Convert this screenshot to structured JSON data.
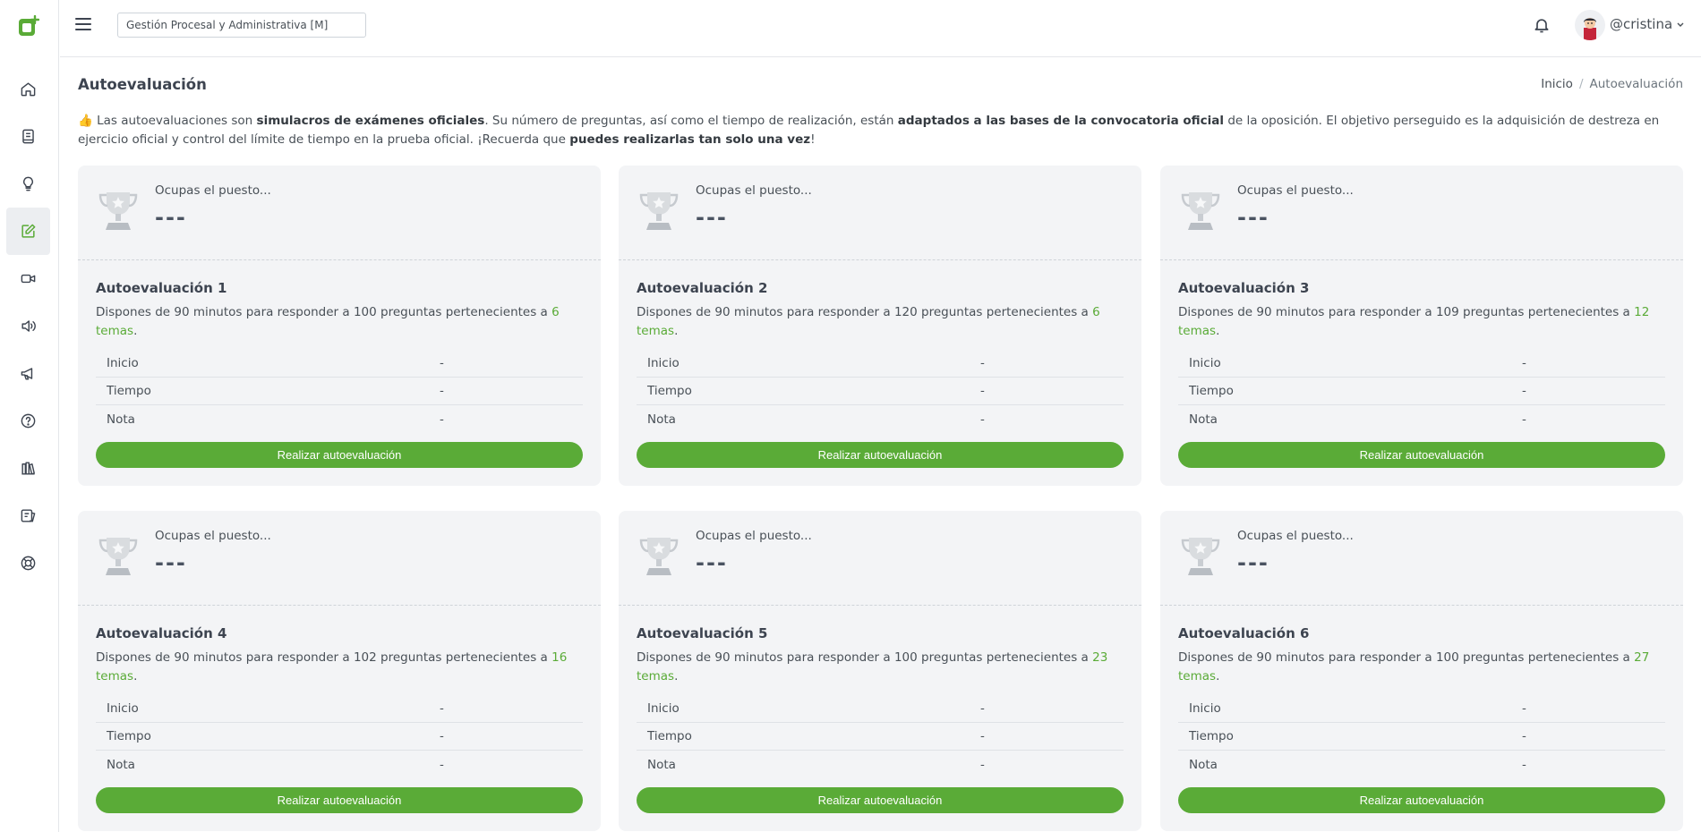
{
  "header": {
    "course": "Gestión Procesal y Administrativa [M]",
    "username": "@cristina"
  },
  "sidebar": {
    "items": [
      {
        "icon": "home-icon"
      },
      {
        "icon": "book-icon"
      },
      {
        "icon": "lightbulb-icon"
      },
      {
        "icon": "edit-icon",
        "active": true
      },
      {
        "icon": "video-icon"
      },
      {
        "icon": "audio-icon"
      },
      {
        "icon": "megaphone-icon"
      },
      {
        "icon": "help-icon"
      },
      {
        "icon": "library-icon"
      },
      {
        "icon": "sketch-icon"
      },
      {
        "icon": "support-icon"
      }
    ]
  },
  "page": {
    "title": "Autoevaluación",
    "breadcrumb": {
      "home": "Inicio",
      "current": "Autoevaluación"
    }
  },
  "intro": {
    "emoji": "👍",
    "t1": "Las autoevaluaciones son ",
    "b1": "simulacros de exámenes oficiales",
    "t2": ". Su número de preguntas, así como el tiempo de realización, están ",
    "b2": "adaptados a las bases de la convocatoria oficial",
    "t3": " de la oposición. El objetivo perseguido es la adquisición de destreza en ejercicio oficial y control del límite de tiempo en la prueba oficial. ¡Recuerda que ",
    "b3": "puedes realizarlas tan solo una vez",
    "t4": "!"
  },
  "card_common": {
    "rank_label": "Ocupas el puesto...",
    "rank_value": "---",
    "desc_prefix": "Dispones de 90 minutos para responder a ",
    "desc_mid": " preguntas pertenecientes a ",
    "desc_end": ".",
    "inicio_label": "Inicio",
    "tiempo_label": "Tiempo",
    "nota_label": "Nota",
    "button": "Realizar autoevaluación"
  },
  "cards": [
    {
      "title": "Autoevaluación 1",
      "questions": "100",
      "temas": "6 temas",
      "inicio": "-",
      "tiempo": "-",
      "nota": "-"
    },
    {
      "title": "Autoevaluación 2",
      "questions": "120",
      "temas": "6 temas",
      "inicio": "-",
      "tiempo": "-",
      "nota": "-"
    },
    {
      "title": "Autoevaluación 3",
      "questions": "109",
      "temas": "12 temas",
      "inicio": "-",
      "tiempo": "-",
      "nota": "-"
    },
    {
      "title": "Autoevaluación 4",
      "questions": "102",
      "temas": "16 temas",
      "inicio": "-",
      "tiempo": "-",
      "nota": "-"
    },
    {
      "title": "Autoevaluación 5",
      "questions": "100",
      "temas": "23 temas",
      "inicio": "-",
      "tiempo": "-",
      "nota": "-"
    },
    {
      "title": "Autoevaluación 6",
      "questions": "100",
      "temas": "27 temas",
      "inicio": "-",
      "tiempo": "-",
      "nota": "-"
    }
  ]
}
